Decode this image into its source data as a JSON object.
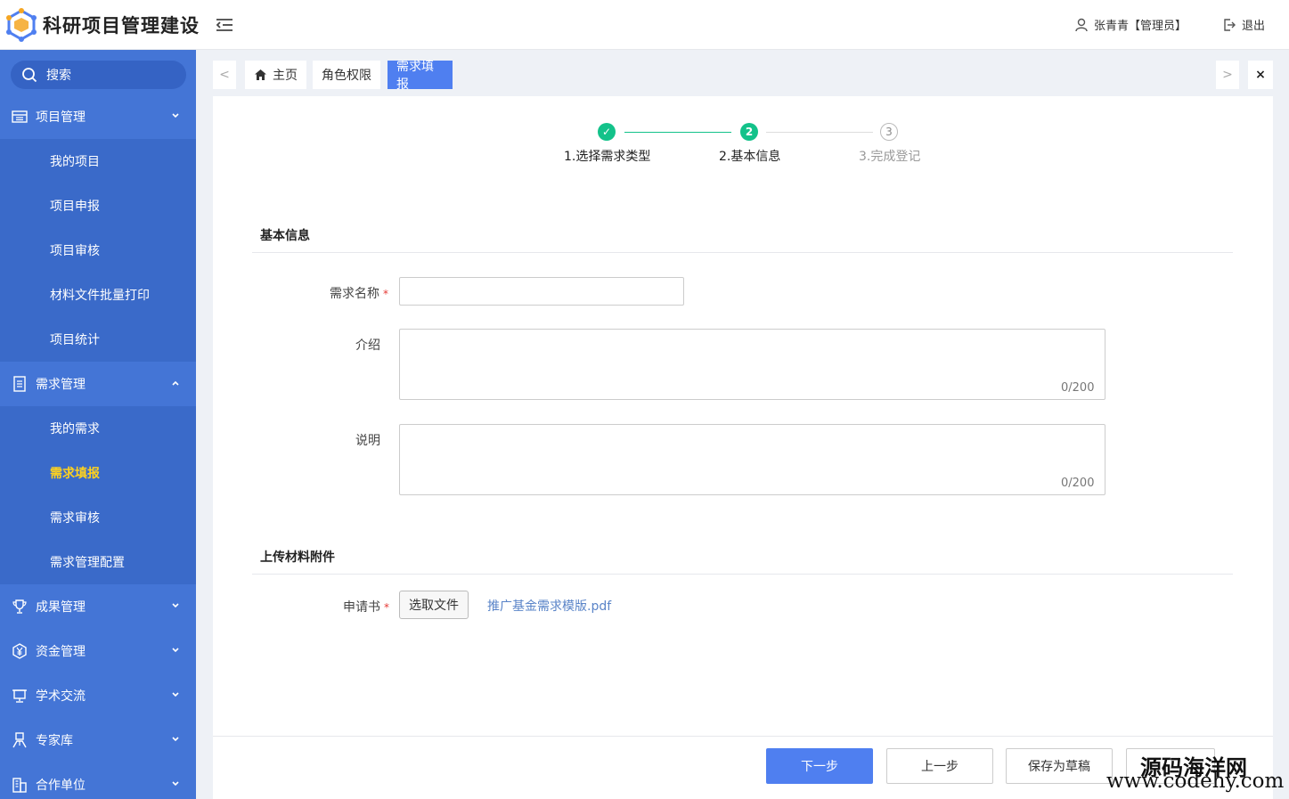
{
  "header": {
    "app_title": "科研项目管理建设",
    "user_name": "张青青【管理员】",
    "logout_label": "退出"
  },
  "sidebar": {
    "search_label": "搜索",
    "groups": [
      {
        "label": "项目管理",
        "icon": "folder-icon",
        "expanded": true,
        "items": [
          "我的项目",
          "项目申报",
          "项目审核",
          "材料文件批量打印",
          "项目统计"
        ]
      },
      {
        "label": "需求管理",
        "icon": "document-icon",
        "expanded": true,
        "items": [
          "我的需求",
          "需求填报",
          "需求审核",
          "需求管理配置"
        ],
        "active_item": "需求填报"
      },
      {
        "label": "成果管理",
        "icon": "trophy-icon",
        "expanded": false
      },
      {
        "label": "资金管理",
        "icon": "yen-icon",
        "expanded": false
      },
      {
        "label": "学术交流",
        "icon": "presentation-icon",
        "expanded": false
      },
      {
        "label": "专家库",
        "icon": "expert-icon",
        "expanded": false
      },
      {
        "label": "合作单位",
        "icon": "building-icon",
        "expanded": false
      }
    ]
  },
  "tabs": {
    "prev_label": "<",
    "next_label": ">",
    "close_label": "×",
    "items": [
      {
        "label": "主页",
        "icon": "home-icon",
        "active": false
      },
      {
        "label": "角色权限",
        "active": false
      },
      {
        "label": "需求填报",
        "active": true
      }
    ]
  },
  "steps": [
    {
      "label": "1.选择需求类型",
      "marker": "✓",
      "state": "done"
    },
    {
      "label": "2.基本信息",
      "marker": "2",
      "state": "active"
    },
    {
      "label": "3.完成登记",
      "marker": "3",
      "state": "pending"
    }
  ],
  "form": {
    "basic_section_title": "基本信息",
    "name_label": "需求名称",
    "name_value": "",
    "required_mark": "*",
    "intro_label": "介绍",
    "intro_value": "",
    "intro_counter": "0/200",
    "desc_label": "说明",
    "desc_value": "",
    "desc_counter": "0/200",
    "upload_section_title": "上传材料附件",
    "application_label": "申请书",
    "choose_file_label": "选取文件",
    "template_file_name": "推广基金需求模版.pdf"
  },
  "footer": {
    "next_label": "下一步",
    "prev_label": "上一步",
    "save_draft_label": "保存为草稿"
  },
  "watermark": {
    "line1": "源码海洋网",
    "line2": "www.codehy.com"
  },
  "colors": {
    "sidebar_bg": "#4475d6",
    "accent": "#4f7ff0",
    "step_green": "#13c28a",
    "active_menu_text": "#ffd21e",
    "required_red": "#e53935"
  }
}
